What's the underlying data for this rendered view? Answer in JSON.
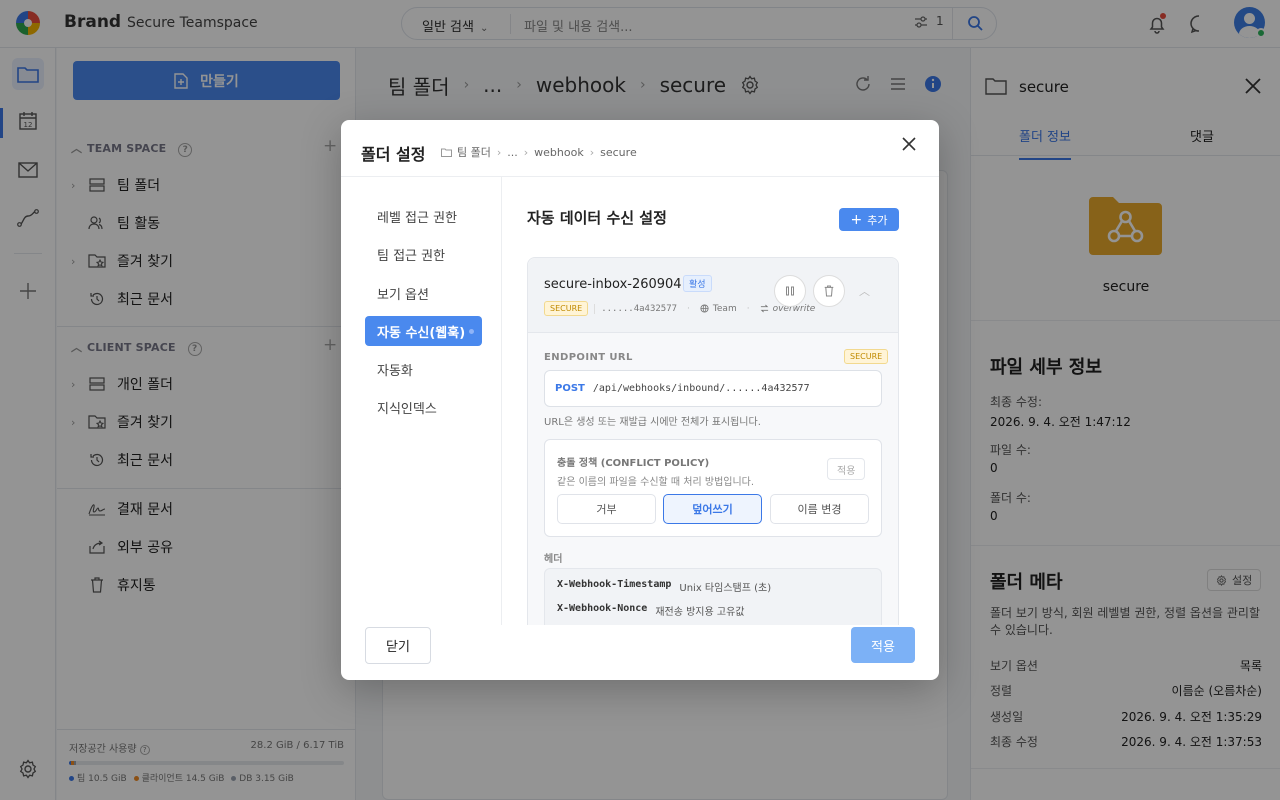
{
  "topbar": {
    "brand": "Brand",
    "team": "Secure Teamspace",
    "search_type": "일반 검색",
    "search_placeholder": "파일 및 내용 검색...",
    "filter_count": "1",
    "icons": [
      "bell-icon",
      "chat-icon",
      "avatar"
    ]
  },
  "rail": {
    "items": [
      "folder-icon",
      "calendar-icon",
      "mail-icon",
      "workflow-icon",
      "plus-icon",
      "settings-icon"
    ],
    "calendar_day": "12"
  },
  "sidebar": {
    "create_label": "만들기",
    "team_space": "TEAM SPACE",
    "team_items": [
      "팀 폴더",
      "팀 활동",
      "즐겨 찾기",
      "최근 문서"
    ],
    "client_space": "CLIENT SPACE",
    "client_items": [
      "개인 폴더",
      "즐겨 찾기",
      "최근 문서"
    ],
    "other_items": [
      "결재 문서",
      "외부 공유",
      "휴지통"
    ],
    "storage": {
      "label": "저장공간 사용량",
      "usage": "28.2 GiB / 6.17 TiB",
      "team": "팀 10.5 GiB",
      "client": "클라이언트 14.5 GiB",
      "db": "DB 3.15 GiB",
      "colors": {
        "team": "#3b78e7",
        "client": "#f08a24",
        "db": "#9aa3b0"
      },
      "fractions": {
        "team": 0.0017,
        "client": 0.0023,
        "db": 0.0005
      }
    }
  },
  "main": {
    "crumb": [
      "팀 폴더",
      "...",
      "webhook",
      "secure"
    ]
  },
  "right_panel": {
    "title": "secure",
    "tabs": [
      "폴더 정보",
      "댓글"
    ],
    "folder_name": "secure",
    "details_title": "파일 세부 정보",
    "modified_label": "최종 수정:",
    "modified_value": "2026. 9. 4. 오전 1:47:12",
    "files_label": "파일 수:",
    "files_value": "0",
    "folders_label": "폴더 수:",
    "folders_value": "0",
    "meta_title": "폴더 메타",
    "meta_button": "설정",
    "meta_desc": "폴더 보기 방식, 회원 레벨별 권한, 정렬 옵션을 관리할 수 있습니다.",
    "meta_rows": [
      {
        "k": "보기 옵션",
        "v": "목록"
      },
      {
        "k": "정렬",
        "v": "이름순 (오름차순)"
      },
      {
        "k": "생성일",
        "v": "2026. 9. 4. 오전 1:35:29"
      },
      {
        "k": "최종 수정",
        "v": "2026. 9. 4. 오전 1:37:53"
      }
    ]
  },
  "modal": {
    "title": "폴더 설정",
    "crumb": [
      "팀 폴더",
      "...",
      "webhook",
      "secure"
    ],
    "nav": [
      "레벨 접근 권한",
      "팀 접근 권한",
      "보기 옵션",
      "자동 수신(웹훅)",
      "자동화",
      "지식인덱스"
    ],
    "section_title": "자동 데이터 수신 설정",
    "add_label": "추가",
    "hook": {
      "name": "secure-inbox-260904",
      "status": "활성",
      "secure_badge": "SECURE",
      "token": "......4a432577",
      "scope": "Team",
      "policy": "overwrite",
      "endpoint_label": "ENDPOINT URL",
      "method": "POST",
      "endpoint_path": "/api/webhooks/inbound/......4a432577",
      "hint": "URL은 생성 또는 재발급 시에만 전체가 표시됩니다.",
      "conflict_title": "충돌 정책 (CONFLICT POLICY)",
      "conflict_desc": "같은 이름의 파일을 수신할 때 처리 방법입니다.",
      "conflict_apply": "적용",
      "options": [
        "거부",
        "덮어쓰기",
        "이름 변경"
      ],
      "selected_option": "덮어쓰기",
      "headers_label": "헤더",
      "headers": [
        {
          "k": "X-Webhook-Timestamp",
          "v": "Unix 타임스탬프 (초)"
        },
        {
          "k": "X-Webhook-Nonce",
          "v": "재전송 방지용 고유값"
        }
      ]
    },
    "close_label": "닫기",
    "apply_label": "적용"
  }
}
